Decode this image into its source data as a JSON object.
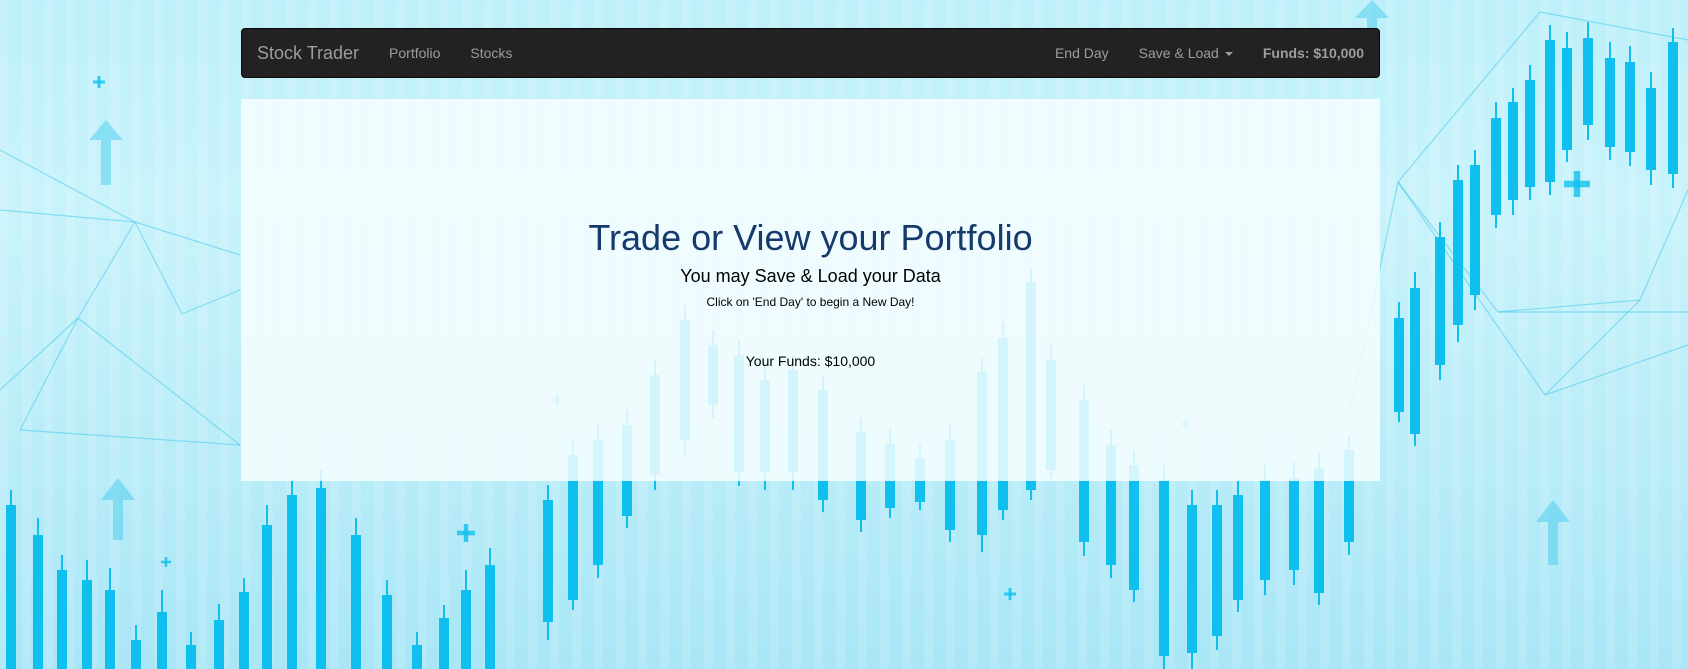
{
  "navbar": {
    "brand": "Stock Trader",
    "links": {
      "portfolio": "Portfolio",
      "stocks": "Stocks"
    },
    "end_day": "End Day",
    "save_load": "Save & Load",
    "funds": "Funds: $10,000"
  },
  "main": {
    "title": "Trade or View your Portfolio",
    "subtitle": "You may Save & Load your Data",
    "hint": "Click on 'End Day' to begin a New Day!",
    "your_funds": "Your Funds: $10,000"
  },
  "colors": {
    "navbar_bg": "#222222",
    "nav_text": "#9d9d9d",
    "title": "#153a6b",
    "candle": "#0fc0ee",
    "background": "#bdf0fa"
  }
}
